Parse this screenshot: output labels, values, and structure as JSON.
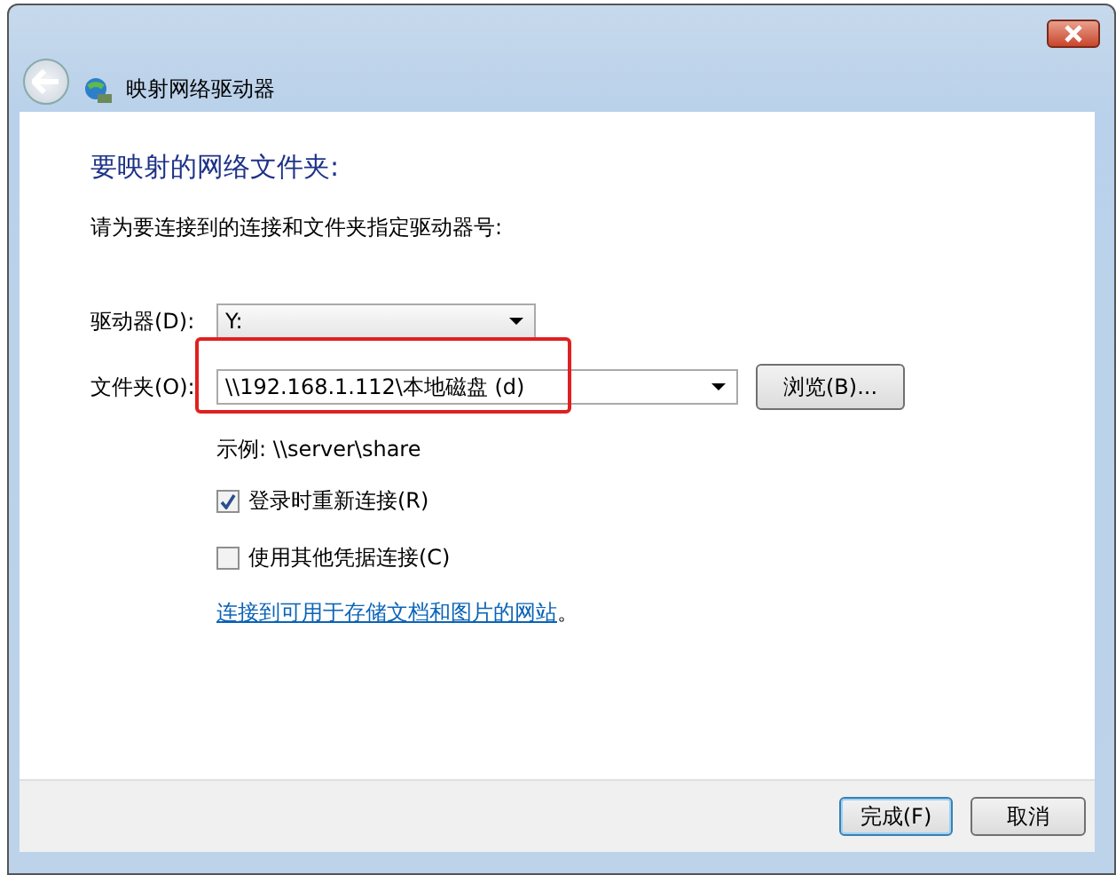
{
  "window": {
    "title": "映射网络驱动器"
  },
  "heading": "要映射的网络文件夹:",
  "instruction": "请为要连接到的连接和文件夹指定驱动器号:",
  "drive": {
    "label": "驱动器(D):",
    "value": "Y:"
  },
  "folder": {
    "label": "文件夹(O):",
    "value": "\\\\192.168.1.112\\本地磁盘 (d)",
    "highlighted": true
  },
  "browse_button": "浏览(B)...",
  "example": "示例: \\\\server\\share",
  "options": [
    {
      "label": "登录时重新连接(R)",
      "checked": true
    },
    {
      "label": "使用其他凭据连接(C)",
      "checked": false
    }
  ],
  "link": "连接到可用于存储文档和图片的网站",
  "link_suffix": "。",
  "buttons": [
    {
      "label": "完成(F)",
      "default": true
    },
    {
      "label": "取消",
      "default": false
    }
  ]
}
